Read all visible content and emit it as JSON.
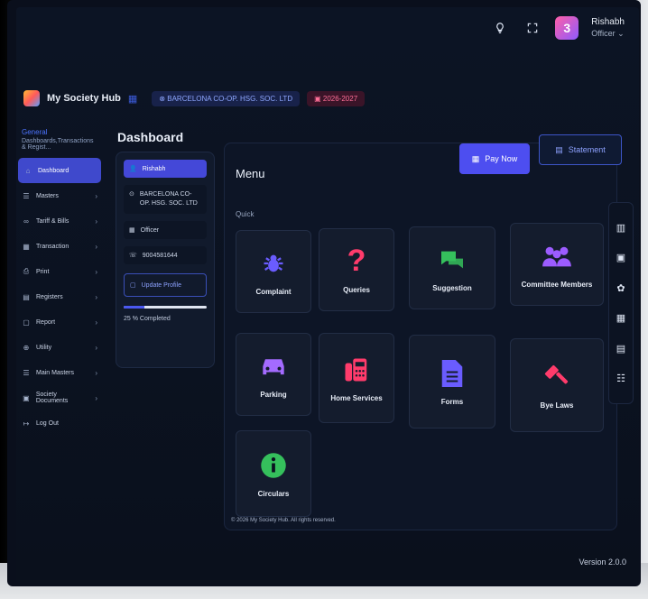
{
  "app": {
    "name": "My Society Hub"
  },
  "header": {
    "society_pill": "BARCELONA CO-OP. HSG. SOC. LTD",
    "year_pill": "2026-2027",
    "user": {
      "name": "Rishabh",
      "role": "Officer"
    }
  },
  "sidebar": {
    "section_title": "General",
    "section_subtitle": "Dashboards,Transactions & Regist...",
    "items": [
      {
        "label": "Dashboard",
        "icon": "home-icon",
        "active": true
      },
      {
        "label": "Masters",
        "icon": "list-icon",
        "chevron": "›"
      },
      {
        "label": "Tariff & Bills",
        "icon": "link-icon",
        "chevron": "›"
      },
      {
        "label": "Transaction",
        "icon": "grid-icon",
        "chevron": "›"
      },
      {
        "label": "Print",
        "icon": "printer-icon",
        "chevron": "›"
      },
      {
        "label": "Registers",
        "icon": "book-icon",
        "chevron": "›"
      },
      {
        "label": "Report",
        "icon": "report-icon",
        "chevron": "›"
      },
      {
        "label": "Utility",
        "icon": "globe-icon",
        "chevron": "›"
      },
      {
        "label": "Main Masters",
        "icon": "list-icon",
        "chevron": "›"
      },
      {
        "label": "Society Documents",
        "icon": "doc-icon",
        "chevron": "›"
      },
      {
        "label": "Log Out",
        "icon": "logout-icon"
      }
    ]
  },
  "page": {
    "title": "Dashboard"
  },
  "profile": {
    "name": "Rishabh",
    "society": "BARCELONA CO-OP. HSG. SOC. LTD",
    "role": "Officer",
    "phone": "9004581644",
    "update_label": "Update Profile",
    "progress": 0.25,
    "progress_text": "25 % Completed"
  },
  "menu": {
    "title": "Menu",
    "quick_label": "Quick",
    "pay_now": "Pay Now",
    "statement": "Statement",
    "tiles": [
      {
        "label": "Complaint",
        "icon": "bug-icon",
        "color": "#6a5cff"
      },
      {
        "label": "Queries",
        "icon": "question-icon",
        "color": "#ff3b6b"
      },
      {
        "label": "Suggestion",
        "icon": "chat-icon",
        "color": "#35c05c"
      },
      {
        "label": "Committee Members",
        "icon": "users-icon",
        "color": "#9c5cff"
      },
      {
        "label": "Parking",
        "icon": "car-icon",
        "color": "#a46bff"
      },
      {
        "label": "Home Services",
        "icon": "fax-icon",
        "color": "#ff3b6b"
      },
      {
        "label": "Forms",
        "icon": "document-icon",
        "color": "#6a5cff"
      },
      {
        "label": "Bye Laws",
        "icon": "gavel-icon",
        "color": "#ff3b6b"
      },
      {
        "label": "Circulars",
        "icon": "info-icon",
        "color": "#35c05c"
      }
    ]
  },
  "footer": {
    "copyright": "© 2026 My Society Hub. All rights reserved.",
    "version": "Version 2.0.0"
  }
}
